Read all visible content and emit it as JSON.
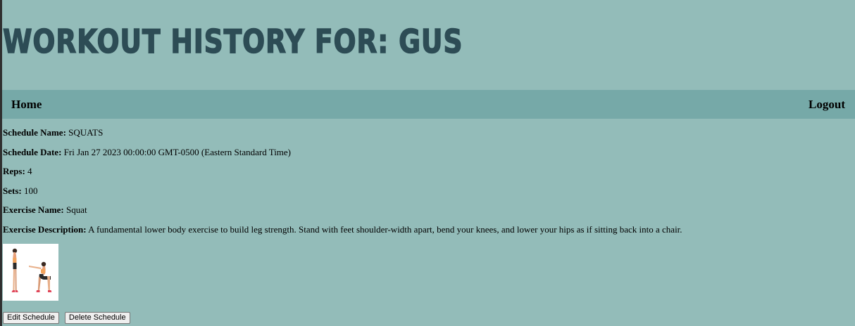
{
  "header": {
    "title": "WORKOUT HISTORY FOR: GUS"
  },
  "navbar": {
    "home_label": "Home",
    "logout_label": "Logout"
  },
  "schedule": {
    "name_label": "Schedule Name:",
    "name_value": "SQUATS",
    "date_label": "Schedule Date:",
    "date_value": "Fri Jan 27 2023 00:00:00 GMT-0500 (Eastern Standard Time)",
    "reps_label": "Reps:",
    "reps_value": "4",
    "sets_label": "Sets:",
    "sets_value": "100",
    "exercise_name_label": "Exercise Name:",
    "exercise_name_value": "Squat",
    "exercise_desc_label": "Exercise Description:",
    "exercise_desc_value": "A fundamental lower body exercise to build leg strength. Stand with feet shoulder-width apart, bend your knees, and lower your hips as if sitting back into a chair."
  },
  "image": {
    "icon": "squat-illustration"
  },
  "actions": {
    "edit_label": "Edit Schedule",
    "delete_label": "Delete Schedule"
  },
  "colors": {
    "background": "#93bcb9",
    "navbar": "#76a9a8",
    "title": "#2d4c55"
  }
}
